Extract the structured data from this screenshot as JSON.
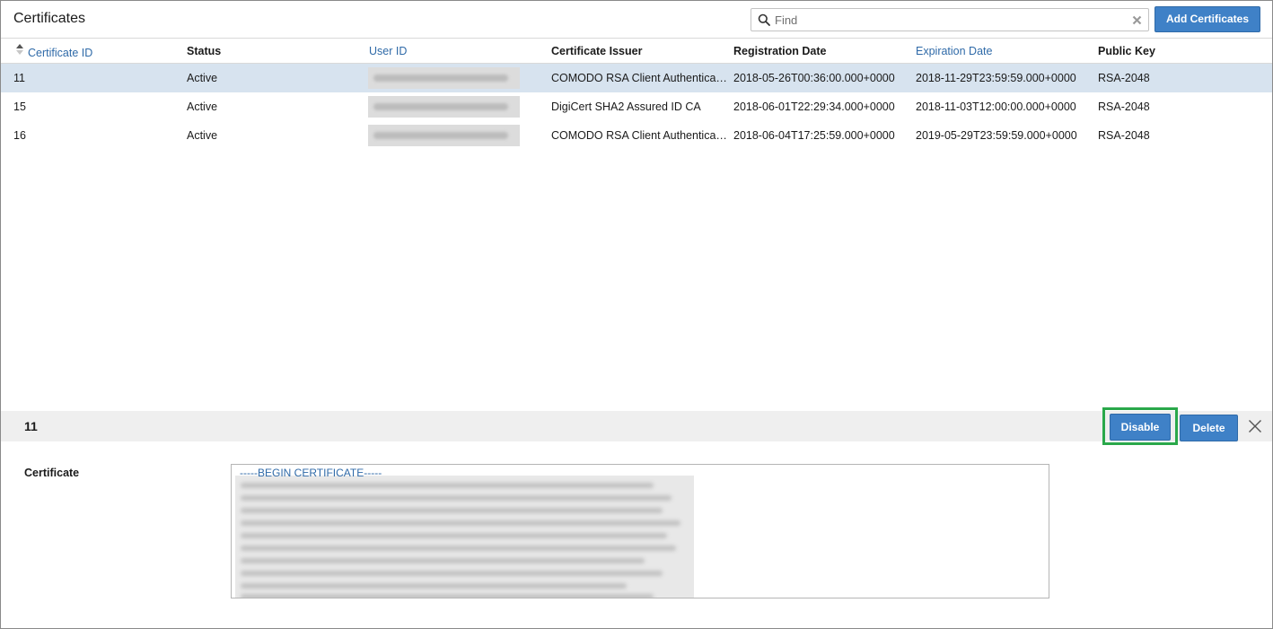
{
  "header": {
    "title": "Certificates",
    "search_placeholder": "Find",
    "add_button": "Add Certificates"
  },
  "table": {
    "columns": [
      "Certificate ID",
      "Status",
      "User ID",
      "Certificate Issuer",
      "Registration Date",
      "Expiration Date",
      "Public Key"
    ],
    "rows": [
      {
        "id": "11",
        "status": "Active",
        "issuer": "COMODO RSA Client Authenticat…",
        "registration": "2018-05-26T00:36:00.000+0000",
        "expiration": "2018-11-29T23:59:59.000+0000",
        "key": "RSA-2048",
        "selected": true
      },
      {
        "id": "15",
        "status": "Active",
        "issuer": "DigiCert SHA2 Assured ID CA",
        "registration": "2018-06-01T22:29:34.000+0000",
        "expiration": "2018-11-03T12:00:00.000+0000",
        "key": "RSA-2048",
        "selected": false
      },
      {
        "id": "16",
        "status": "Active",
        "issuer": "COMODO RSA Client Authenticat…",
        "registration": "2018-06-04T17:25:59.000+0000",
        "expiration": "2019-05-29T23:59:59.000+0000",
        "key": "RSA-2048",
        "selected": false
      }
    ]
  },
  "detail": {
    "id": "11",
    "disable_button": "Disable",
    "delete_button": "Delete",
    "certificate_label": "Certificate",
    "certificate_begin": "-----BEGIN CERTIFICATE-----"
  },
  "colors": {
    "accent": "#3f81c7",
    "selected_row": "#d7e3ef",
    "highlight_outline": "#2aa84a",
    "link": "#2f6aa8"
  }
}
